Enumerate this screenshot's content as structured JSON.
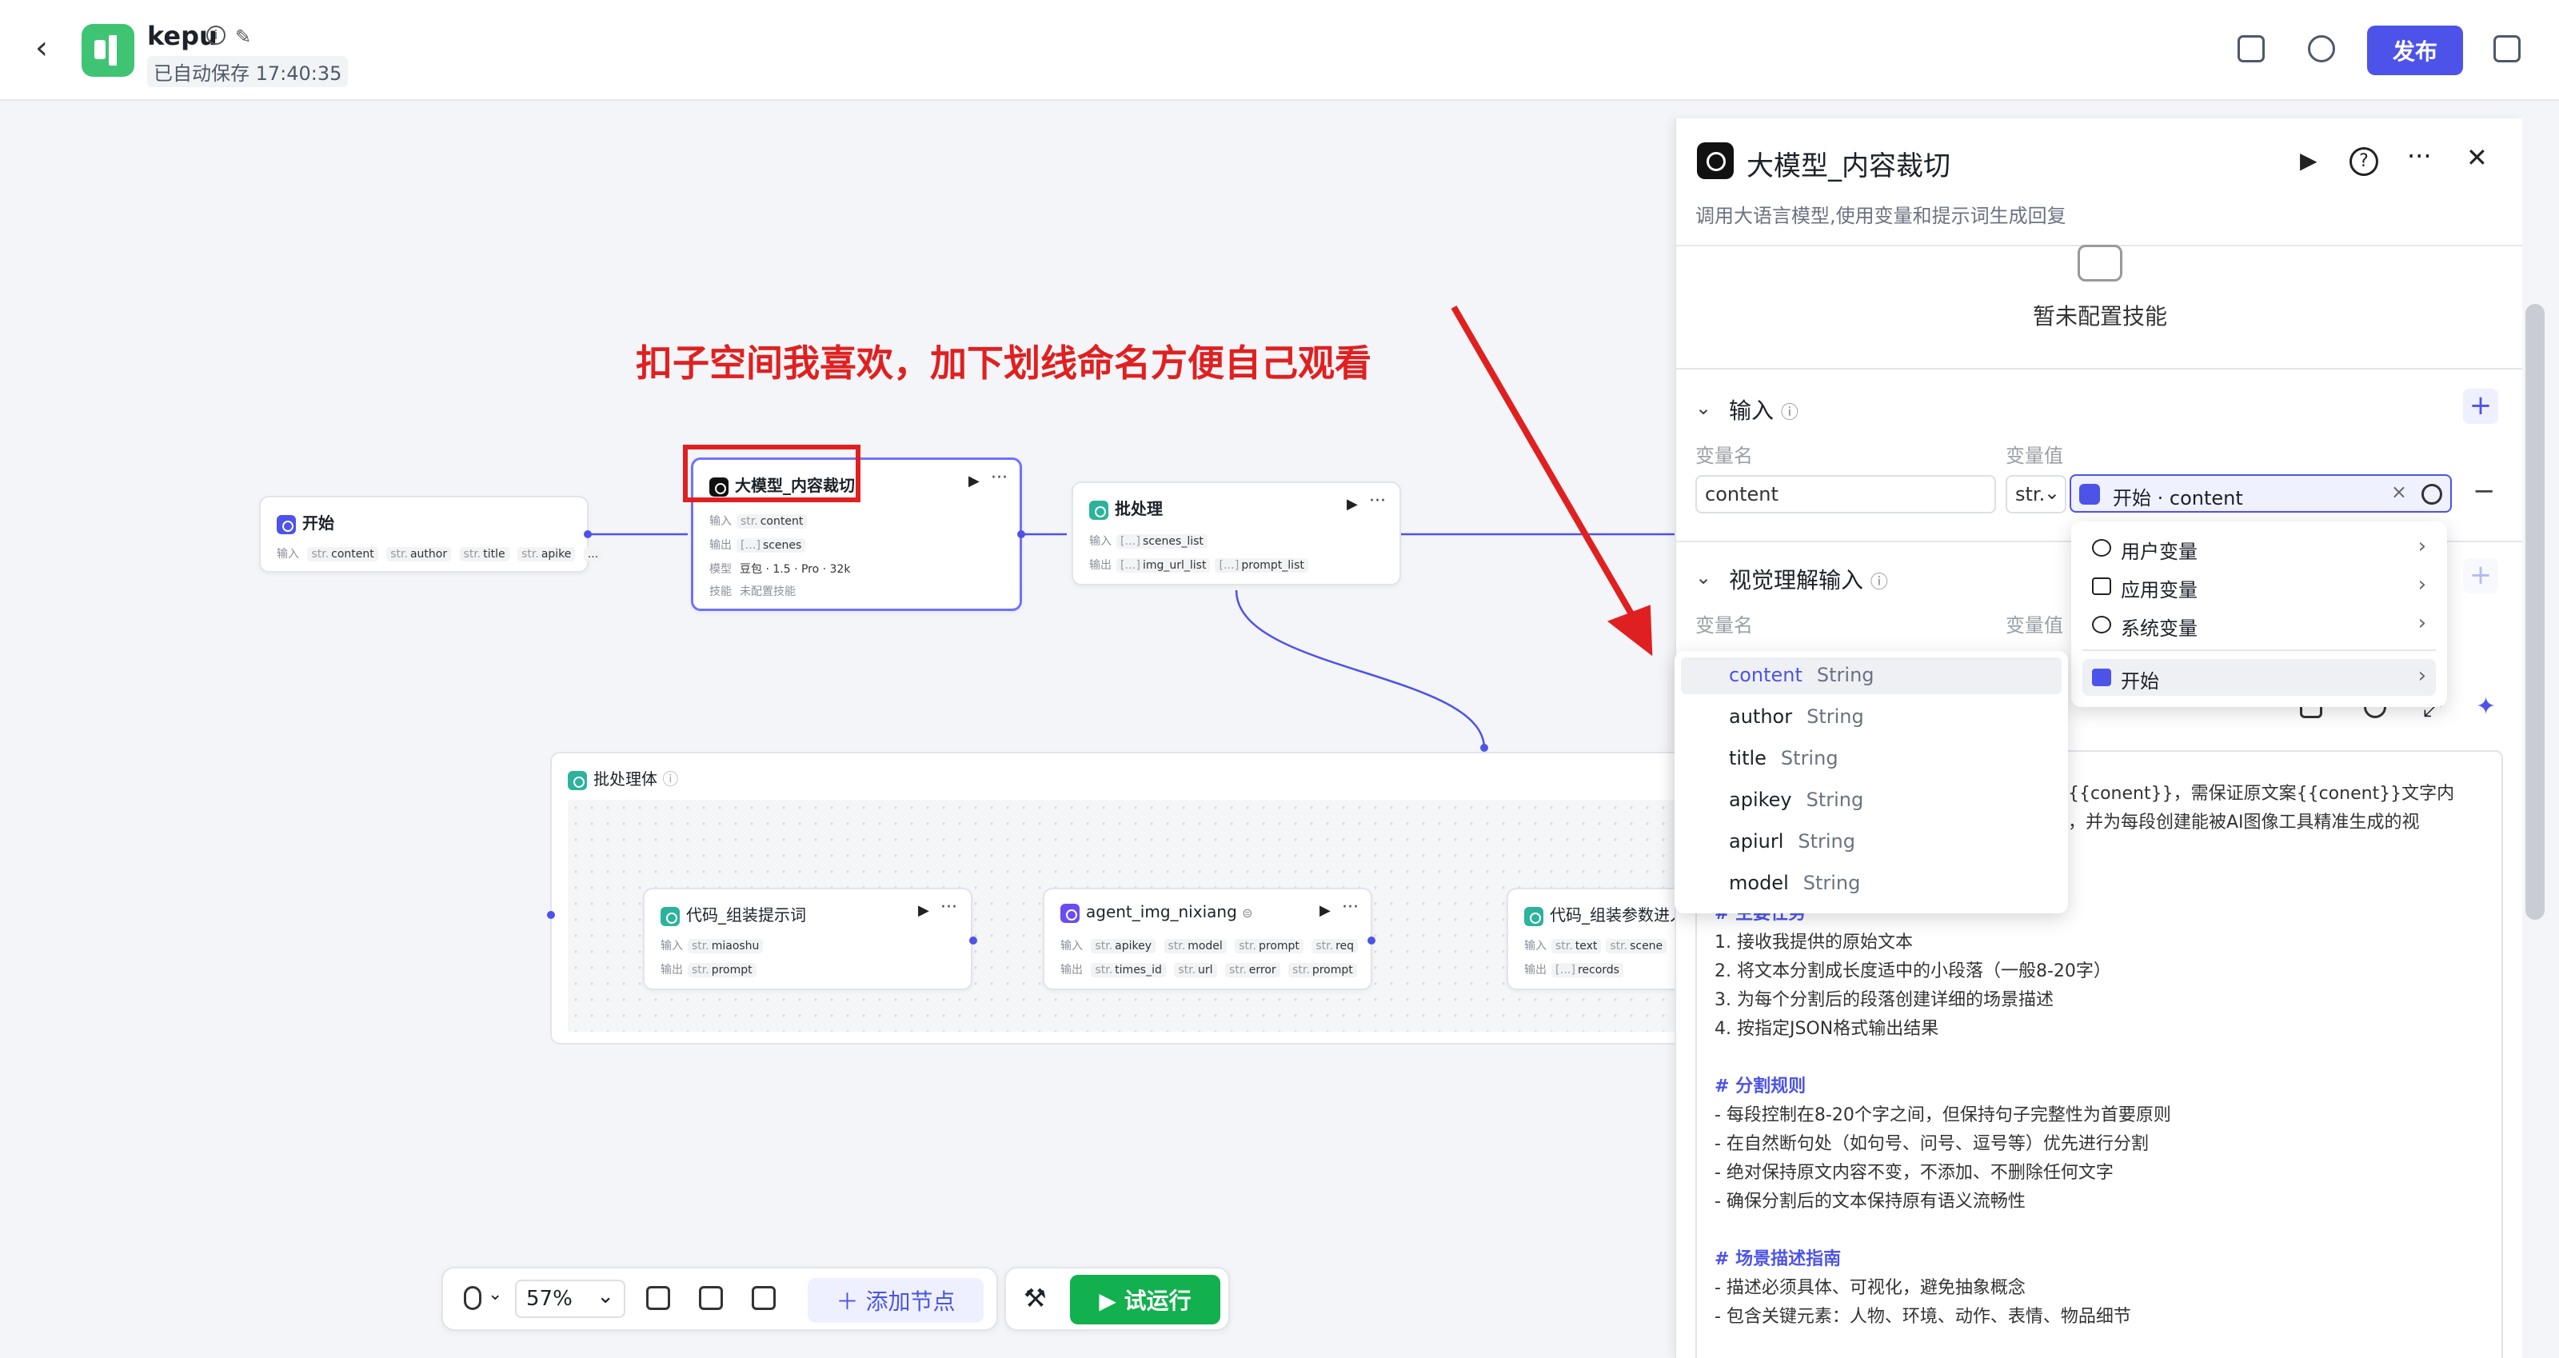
{
  "header": {
    "app_name": "kepu",
    "autosave": "已自动保存 17:40:35",
    "publish_label": "发布"
  },
  "annotation": "扣子空间我喜欢，加下划线命名方便自己观看",
  "nodes": {
    "start": {
      "title": "开始",
      "input_label": "输入",
      "inputs": [
        "content",
        "author",
        "title",
        "apike"
      ],
      "more": "..."
    },
    "llm": {
      "title": "大模型_内容裁切",
      "input_label": "输入",
      "input": "content",
      "output_label": "输出",
      "output": "scenes",
      "model_label": "模型",
      "model": "豆包 · 1.5 · Pro · 32k",
      "skill_label": "技能",
      "skill": "未配置技能"
    },
    "batch": {
      "title": "批处理",
      "input_label": "输入",
      "input": "scenes_list",
      "output_label": "输出",
      "outputs": [
        "img_url_list",
        "prompt_list"
      ]
    },
    "batch_body": {
      "title": "批处理体"
    },
    "code1": {
      "title": "代码_组装提示词",
      "input_label": "输入",
      "input": "miaoshu",
      "output_label": "输出",
      "output": "prompt"
    },
    "agent": {
      "title": "agent_img_nixiang",
      "input_label": "输入",
      "inputs": [
        "apikey",
        "model",
        "prompt",
        "req"
      ],
      "output_label": "输出",
      "outputs": [
        "times_id",
        "url",
        "error",
        "prompt"
      ]
    },
    "code2": {
      "title": "代码_组装参数进入",
      "input_label": "输入",
      "inputs": [
        "text",
        "scene"
      ],
      "output_label": "输出",
      "output": "records"
    }
  },
  "toolbar": {
    "zoom": "57%",
    "add_node": "添加节点",
    "run": "试运行"
  },
  "panel": {
    "title": "大模型_内容裁切",
    "subtitle": "调用大语言模型,使用变量和提示词生成回复",
    "empty_skill": "暂未配置技能",
    "input_section": "输入",
    "var_name_label": "变量名",
    "var_value_label": "变量值",
    "var_name": "content",
    "var_type": "str.",
    "var_ref": "开始 · content",
    "vision_section": "视觉理解输入",
    "vision_var_name_label": "变量名",
    "vision_var_value_label": "变量值",
    "prompt_lines": [
      "入的{{conent}}，需保证原文案{{conent}}文字内",
      "片段，并为每段创建能被AI图像工具精准生成的视",
      "# 主要任务",
      "1. 接收我提供的原始文本",
      "2. 将文本分割成长度适中的小段落（一般8-20字）",
      "3. 为每个分割后的段落创建详细的场景描述",
      "4. 按指定JSON格式输出结果",
      "# 分割规则",
      "- 每段控制在8-20个字之间，但保持句子完整性为首要原则",
      "- 在自然断句处（如句号、问号、逗号等）优先进行分割",
      "- 绝对保持原文内容不变，不添加、不删除任何文字",
      "- 确保分割后的文本保持原有语义流畅性",
      "# 场景描述指南",
      "- 描述必须具体、可视化，避免抽象概念",
      "- 包含关键元素：人物、环境、动作、表情、物品细节"
    ]
  },
  "var_dropdown": [
    {
      "label": "用户变量"
    },
    {
      "label": "应用变量"
    },
    {
      "label": "系统变量"
    },
    {
      "label": "开始"
    }
  ],
  "field_list": [
    {
      "name": "content",
      "type": "String"
    },
    {
      "name": "author",
      "type": "String"
    },
    {
      "name": "title",
      "type": "String"
    },
    {
      "name": "apikey",
      "type": "String"
    },
    {
      "name": "apiurl",
      "type": "String"
    },
    {
      "name": "model",
      "type": "String"
    }
  ],
  "colors": {
    "accent": "#4d53e8",
    "annotation_red": "#e02020",
    "run_green": "#12b04e"
  }
}
